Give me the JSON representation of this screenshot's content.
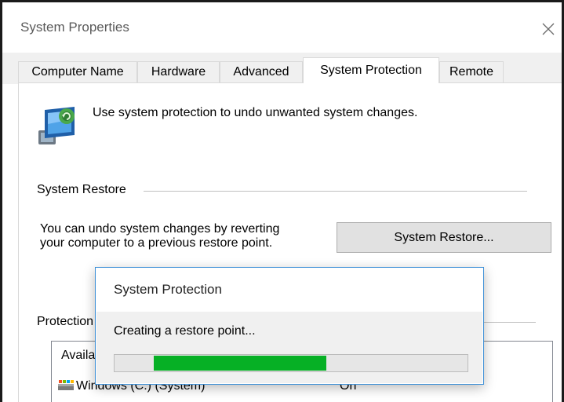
{
  "window": {
    "title": "System Properties"
  },
  "tabs": [
    {
      "label": "Computer Name",
      "active": false
    },
    {
      "label": "Hardware",
      "active": false
    },
    {
      "label": "Advanced",
      "active": false
    },
    {
      "label": "System Protection",
      "active": true
    },
    {
      "label": "Remote",
      "active": false
    }
  ],
  "intro": {
    "text": "Use system protection to undo unwanted system changes."
  },
  "system_restore": {
    "group_title": "System Restore",
    "description_line1": "You can undo system changes by reverting",
    "description_line2": "your computer to a previous restore point.",
    "button_label": "System Restore..."
  },
  "protection": {
    "group_title": "Protection",
    "column_header": "Available Drives",
    "drive_name": "Windows (C:) (System)",
    "drive_status": "On"
  },
  "dialog": {
    "title": "System Protection",
    "message": "Creating a restore point...",
    "progress": {
      "start": 0.11,
      "end": 0.6,
      "color": "#06b025"
    }
  },
  "colors": {
    "accent": "#3c8fd7",
    "progress": "#06b025"
  },
  "icons": {
    "close": "close-icon",
    "system": "system-protection-icon",
    "drive": "drive-icon"
  }
}
